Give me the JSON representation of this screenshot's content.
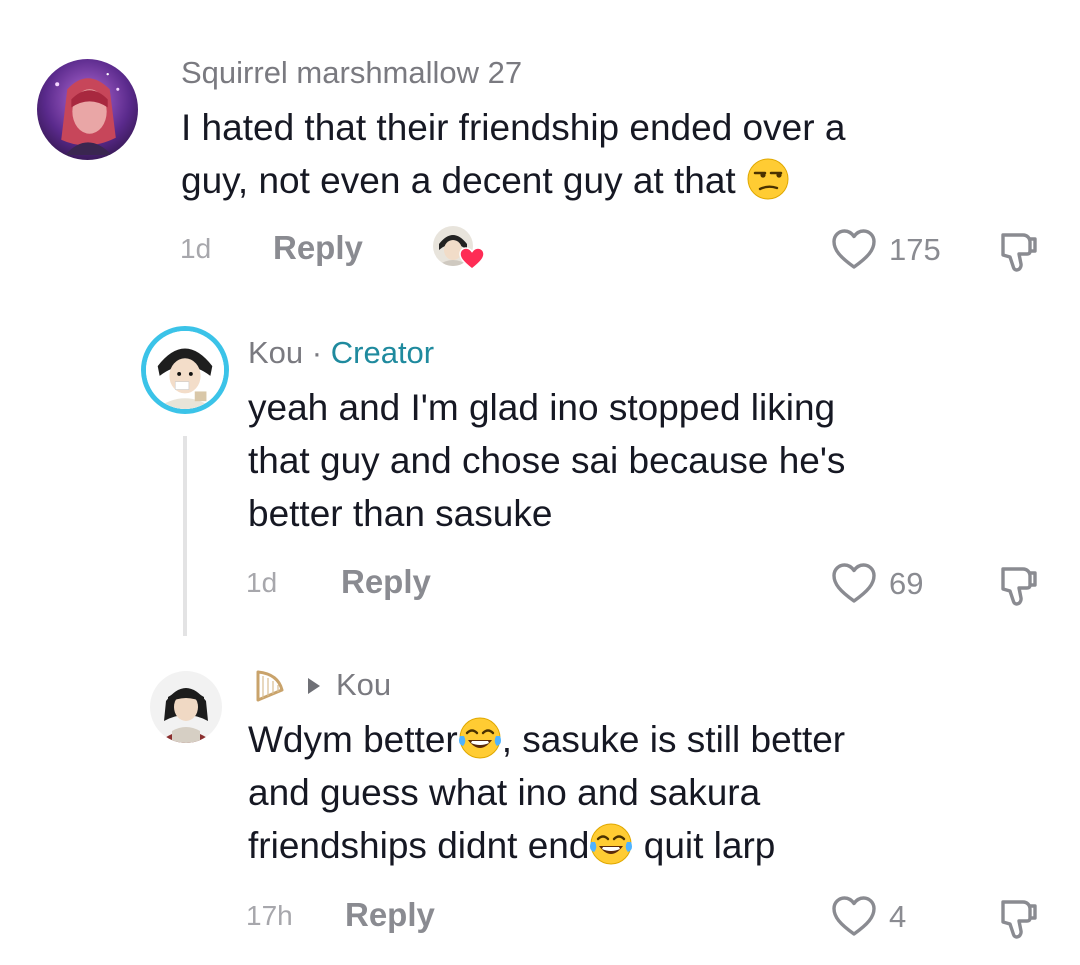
{
  "comments": [
    {
      "username": "Squirrel marshmallow 27",
      "text_lines": [
        "I hated that their friendship ended over a",
        "guy, not even a decent guy at that"
      ],
      "emoji": "unamused-face-emoji",
      "time": "1d",
      "reply_label": "Reply",
      "likes": "175",
      "liked_by_creator": true
    },
    {
      "username": "Kou",
      "separator": "·",
      "badge": "Creator",
      "text_lines": [
        "yeah and I'm glad ino stopped liking",
        "that guy and chose sai because he's",
        "better than sasuke"
      ],
      "time": "1d",
      "reply_label": "Reply",
      "likes": "69"
    },
    {
      "reply_to": "Kou",
      "text_line1_a": "Wdym better",
      "text_line1_b": ", sasuke is still better",
      "text_line2": "and guess what ino and sakura",
      "text_line3_a": "friendships didnt end",
      "text_line3_b": " quit larp",
      "emoji": "tears-of-joy-emoji",
      "time": "17h",
      "reply_label": "Reply",
      "likes": "4"
    }
  ],
  "icons": {
    "like": "heart-outline-icon",
    "dislike": "thumbs-down-icon",
    "reply_arrow": "triangle-right-icon",
    "user_badge": "harp-icon"
  },
  "colors": {
    "creator_accent": "#1f8a9e",
    "heart_red": "#fe2c55",
    "muted_text": "#8a8b91"
  }
}
